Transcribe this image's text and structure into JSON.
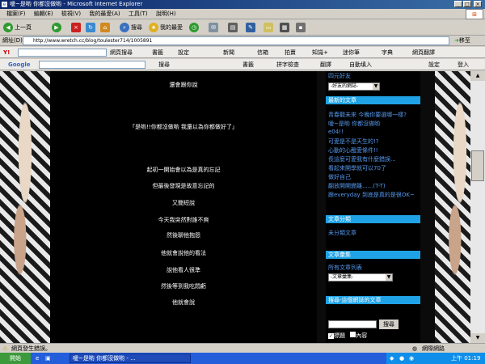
{
  "window": {
    "title": "噯~是喲 你都沒做喲 - Microsoft Internet Explorer",
    "controls": [
      "_",
      "□",
      "×"
    ]
  },
  "menu": [
    "檔案(F)",
    "編輯(E)",
    "檢視(V)",
    "我的最愛(A)",
    "工具(T)",
    "說明(H)"
  ],
  "toolbar": {
    "back": "上一頁",
    "search": "搜尋",
    "favorites": "我的最愛"
  },
  "address": {
    "label": "網址(D)",
    "url": "http://www.wretch.cc/blog/toulester714/1005891",
    "go": "移至"
  },
  "yahoo_bar": {
    "search_btn": "網頁搜尋",
    "items": [
      "書籤",
      "設定",
      "新聞",
      "信箱",
      "拍賣",
      "知識+",
      "迷你筆",
      "字典",
      "網頁翻譯"
    ]
  },
  "google_bar": {
    "logo": "Google",
    "search_btn": "搜尋",
    "items": [
      "書籤",
      "拼字檢查",
      "翻譯",
      "自動填入",
      "設定",
      "登入"
    ]
  },
  "post_lines": [
    "還會跟你說",
    "「是喲!!你都沒做喲 我還以為你都做好了」",
    "起初一開始會以為是真的忘記",
    "但最後發現是故意忘記的",
    "又簡短說",
    "今天我突然對誰不爽",
    "然後聊他抱怨",
    "他就會說他的看法",
    "說他看人很準",
    "然後等到我吃悶虧",
    "他就會說"
  ],
  "sidebar": {
    "top_label": "四元好友",
    "friends_select": "-好友的網誌-",
    "latest_header": "最新的文章",
    "latest_posts": [
      "青春觀未來 今晚你要選哪一樣?",
      "噯~是喲 你都沒做喲",
      "e04!!",
      "可愛是不是天生的!?",
      "心動的心醒愛條件!!",
      "長這麼可愛我有什麼錯誤...",
      "看起來開學就可以70了",
      "做好自己",
      "翻放開開變離......(T-T)",
      "跟everyday 到底是真的是很OK~"
    ],
    "category_header": "文章分類",
    "category_item": "未分類文章",
    "collection_header": "文章彙集",
    "collection_label": "所有文章列表",
    "collection_select": "-文章彙集-",
    "search_header": "搜尋-這個網誌的文章",
    "search_btn": "搜尋",
    "check_title": "標題",
    "check_content": "內容"
  },
  "status": {
    "text": "網頁發生錯誤。",
    "zone": "網際網路"
  },
  "taskbar": {
    "start": "開始",
    "task": "噯~是喲 你都沒做喲 - ...",
    "clock": "上午 01:19"
  }
}
